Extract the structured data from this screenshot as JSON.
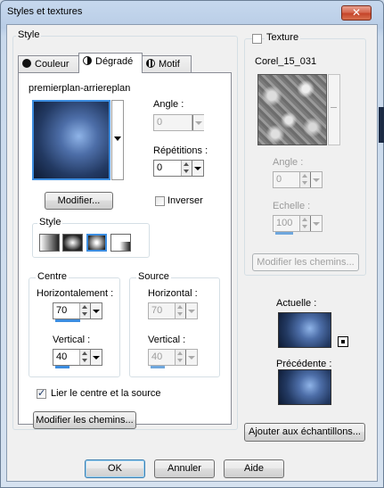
{
  "window": {
    "title": "Styles et textures",
    "close_glyph": "✕"
  },
  "style_group": {
    "label": "Style",
    "tabs": [
      {
        "label": "Couleur",
        "icon": "filled-circle-icon"
      },
      {
        "label": "Dégradé",
        "icon": "half-circle-icon",
        "active": true
      },
      {
        "label": "Motif",
        "icon": "grid-circle-icon"
      }
    ]
  },
  "gradient": {
    "name": "premierplan-arriereplan",
    "modify_button": "Modifier...",
    "angle_label": "Angle :",
    "angle_value": "0",
    "repetitions_label": "Répétitions :",
    "repetitions_value": "0",
    "invert_label": "Inverser",
    "invert_checked": false,
    "style_label": "Style",
    "style_options": [
      "linear-style-icon",
      "rectangular-style-icon",
      "sunburst-style-icon",
      "radial-corner-style-icon"
    ],
    "selected_style_index": 2
  },
  "centre": {
    "label": "Centre",
    "h_label": "Horizontalement :",
    "h_value": "70",
    "v_label": "Vertical :",
    "v_value": "40"
  },
  "source": {
    "label": "Source",
    "h_label": "Horizontal :",
    "h_value": "70",
    "v_label": "Vertical :",
    "v_value": "40"
  },
  "link_label": "Lier le centre et la source",
  "link_checked": true,
  "modify_paths_left": "Modifier les chemins...",
  "texture": {
    "checkbox_label": "Texture",
    "checked": false,
    "name": "Corel_15_031",
    "angle_label": "Angle :",
    "angle_value": "0",
    "scale_label": "Echelle :",
    "scale_value": "100",
    "modify_paths": "Modifier les chemins..."
  },
  "current_label": "Actuelle :",
  "previous_label": "Précédente :",
  "add_to_swatches": "Ajouter aux échantillons...",
  "buttons": {
    "ok": "OK",
    "cancel": "Annuler",
    "help": "Aide"
  },
  "colors": {
    "accent": "#3c8de0",
    "gradient_light": "#8fb4e8",
    "gradient_dark": "#0d1a33"
  }
}
